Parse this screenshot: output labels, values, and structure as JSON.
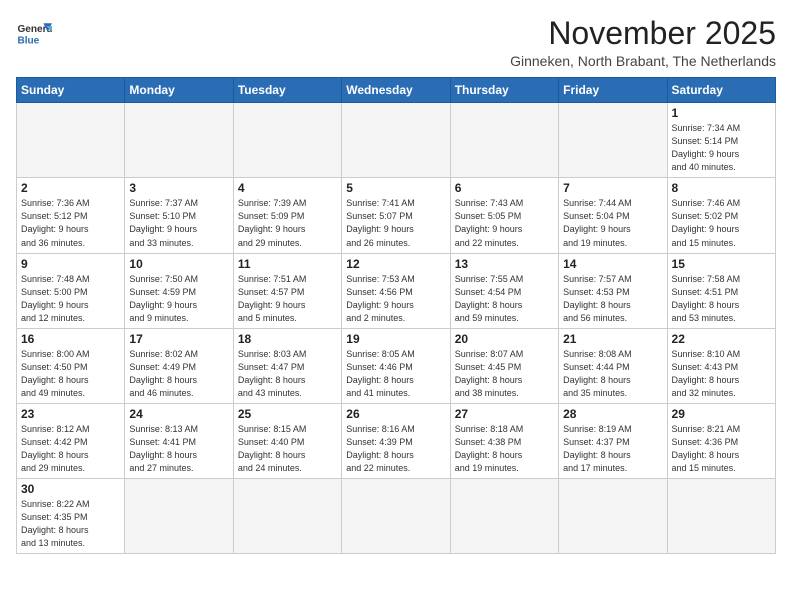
{
  "logo": {
    "line1": "General",
    "line2": "Blue"
  },
  "header": {
    "title": "November 2025",
    "subtitle": "Ginneken, North Brabant, The Netherlands"
  },
  "weekdays": [
    "Sunday",
    "Monday",
    "Tuesday",
    "Wednesday",
    "Thursday",
    "Friday",
    "Saturday"
  ],
  "weeks": [
    [
      {
        "day": "",
        "info": ""
      },
      {
        "day": "",
        "info": ""
      },
      {
        "day": "",
        "info": ""
      },
      {
        "day": "",
        "info": ""
      },
      {
        "day": "",
        "info": ""
      },
      {
        "day": "",
        "info": ""
      },
      {
        "day": "1",
        "info": "Sunrise: 7:34 AM\nSunset: 5:14 PM\nDaylight: 9 hours\nand 40 minutes."
      }
    ],
    [
      {
        "day": "2",
        "info": "Sunrise: 7:36 AM\nSunset: 5:12 PM\nDaylight: 9 hours\nand 36 minutes."
      },
      {
        "day": "3",
        "info": "Sunrise: 7:37 AM\nSunset: 5:10 PM\nDaylight: 9 hours\nand 33 minutes."
      },
      {
        "day": "4",
        "info": "Sunrise: 7:39 AM\nSunset: 5:09 PM\nDaylight: 9 hours\nand 29 minutes."
      },
      {
        "day": "5",
        "info": "Sunrise: 7:41 AM\nSunset: 5:07 PM\nDaylight: 9 hours\nand 26 minutes."
      },
      {
        "day": "6",
        "info": "Sunrise: 7:43 AM\nSunset: 5:05 PM\nDaylight: 9 hours\nand 22 minutes."
      },
      {
        "day": "7",
        "info": "Sunrise: 7:44 AM\nSunset: 5:04 PM\nDaylight: 9 hours\nand 19 minutes."
      },
      {
        "day": "8",
        "info": "Sunrise: 7:46 AM\nSunset: 5:02 PM\nDaylight: 9 hours\nand 15 minutes."
      }
    ],
    [
      {
        "day": "9",
        "info": "Sunrise: 7:48 AM\nSunset: 5:00 PM\nDaylight: 9 hours\nand 12 minutes."
      },
      {
        "day": "10",
        "info": "Sunrise: 7:50 AM\nSunset: 4:59 PM\nDaylight: 9 hours\nand 9 minutes."
      },
      {
        "day": "11",
        "info": "Sunrise: 7:51 AM\nSunset: 4:57 PM\nDaylight: 9 hours\nand 5 minutes."
      },
      {
        "day": "12",
        "info": "Sunrise: 7:53 AM\nSunset: 4:56 PM\nDaylight: 9 hours\nand 2 minutes."
      },
      {
        "day": "13",
        "info": "Sunrise: 7:55 AM\nSunset: 4:54 PM\nDaylight: 8 hours\nand 59 minutes."
      },
      {
        "day": "14",
        "info": "Sunrise: 7:57 AM\nSunset: 4:53 PM\nDaylight: 8 hours\nand 56 minutes."
      },
      {
        "day": "15",
        "info": "Sunrise: 7:58 AM\nSunset: 4:51 PM\nDaylight: 8 hours\nand 53 minutes."
      }
    ],
    [
      {
        "day": "16",
        "info": "Sunrise: 8:00 AM\nSunset: 4:50 PM\nDaylight: 8 hours\nand 49 minutes."
      },
      {
        "day": "17",
        "info": "Sunrise: 8:02 AM\nSunset: 4:49 PM\nDaylight: 8 hours\nand 46 minutes."
      },
      {
        "day": "18",
        "info": "Sunrise: 8:03 AM\nSunset: 4:47 PM\nDaylight: 8 hours\nand 43 minutes."
      },
      {
        "day": "19",
        "info": "Sunrise: 8:05 AM\nSunset: 4:46 PM\nDaylight: 8 hours\nand 41 minutes."
      },
      {
        "day": "20",
        "info": "Sunrise: 8:07 AM\nSunset: 4:45 PM\nDaylight: 8 hours\nand 38 minutes."
      },
      {
        "day": "21",
        "info": "Sunrise: 8:08 AM\nSunset: 4:44 PM\nDaylight: 8 hours\nand 35 minutes."
      },
      {
        "day": "22",
        "info": "Sunrise: 8:10 AM\nSunset: 4:43 PM\nDaylight: 8 hours\nand 32 minutes."
      }
    ],
    [
      {
        "day": "23",
        "info": "Sunrise: 8:12 AM\nSunset: 4:42 PM\nDaylight: 8 hours\nand 29 minutes."
      },
      {
        "day": "24",
        "info": "Sunrise: 8:13 AM\nSunset: 4:41 PM\nDaylight: 8 hours\nand 27 minutes."
      },
      {
        "day": "25",
        "info": "Sunrise: 8:15 AM\nSunset: 4:40 PM\nDaylight: 8 hours\nand 24 minutes."
      },
      {
        "day": "26",
        "info": "Sunrise: 8:16 AM\nSunset: 4:39 PM\nDaylight: 8 hours\nand 22 minutes."
      },
      {
        "day": "27",
        "info": "Sunrise: 8:18 AM\nSunset: 4:38 PM\nDaylight: 8 hours\nand 19 minutes."
      },
      {
        "day": "28",
        "info": "Sunrise: 8:19 AM\nSunset: 4:37 PM\nDaylight: 8 hours\nand 17 minutes."
      },
      {
        "day": "29",
        "info": "Sunrise: 8:21 AM\nSunset: 4:36 PM\nDaylight: 8 hours\nand 15 minutes."
      }
    ],
    [
      {
        "day": "30",
        "info": "Sunrise: 8:22 AM\nSunset: 4:35 PM\nDaylight: 8 hours\nand 13 minutes."
      },
      {
        "day": "",
        "info": ""
      },
      {
        "day": "",
        "info": ""
      },
      {
        "day": "",
        "info": ""
      },
      {
        "day": "",
        "info": ""
      },
      {
        "day": "",
        "info": ""
      },
      {
        "day": "",
        "info": ""
      }
    ]
  ]
}
